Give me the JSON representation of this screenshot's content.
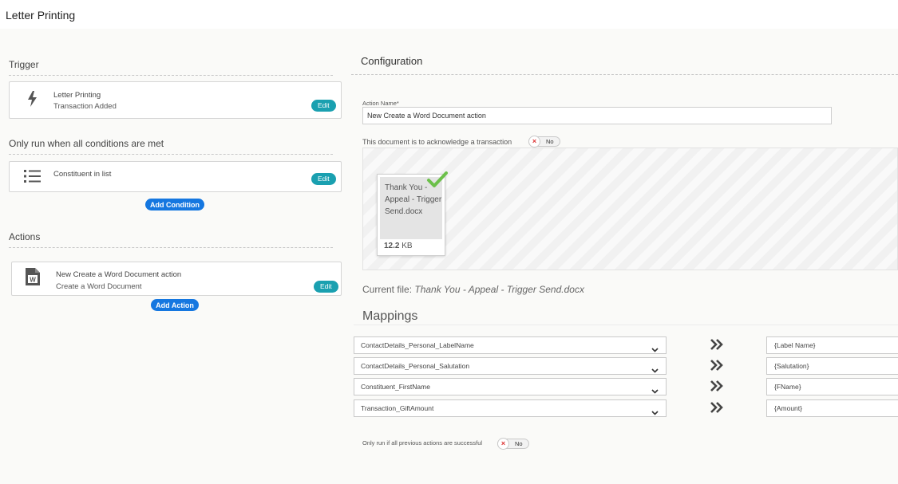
{
  "header": {
    "title": "Letter Printing"
  },
  "left": {
    "trigger_label": "Trigger",
    "trigger_card": {
      "title": "Letter Printing",
      "subtitle": "Transaction Added",
      "edit": "Edit",
      "icon": "lightning-bolt-icon"
    },
    "conditions_label": "Only run when all conditions are met",
    "condition_card": {
      "title": "Constituent in list",
      "edit": "Edit",
      "icon": "list-icon"
    },
    "add_condition": "Add Condition",
    "actions_label": "Actions",
    "action_card": {
      "title": "New Create a Word Document action",
      "subtitle": "Create a Word Document",
      "edit": "Edit",
      "icon": "word-document-icon"
    },
    "add_action": "Add Action"
  },
  "config": {
    "title": "Configuration",
    "action_name_label": "Action Name*",
    "action_name_value": "New Create a Word Document action",
    "acknowledge_label": "This document is to acknowledge a transaction",
    "acknowledge_toggle": "No",
    "file": {
      "name": "Thank You - Appeal - Trigger Send.docx",
      "size_num": "12.2",
      "size_unit": "KB"
    },
    "current_file_label": "Current file:",
    "current_file_name": "Thank You - Appeal - Trigger Send.docx",
    "mappings_title": "Mappings",
    "mappings": [
      {
        "field": "ContactDetails_Personal_LabelName",
        "target": "{Label Name}"
      },
      {
        "field": "ContactDetails_Personal_Salutation",
        "target": "{Salutation}"
      },
      {
        "field": "Constituent_FirstName",
        "target": "{FName}"
      },
      {
        "field": "Transaction_GiftAmount",
        "target": "{Amount}"
      }
    ],
    "only_run_label": "Only run if all previous actions are successful",
    "only_run_toggle": "No"
  },
  "colors": {
    "edit_button": "#1aa0b0",
    "add_button": "#1577e0",
    "check": "#6cc04a"
  }
}
